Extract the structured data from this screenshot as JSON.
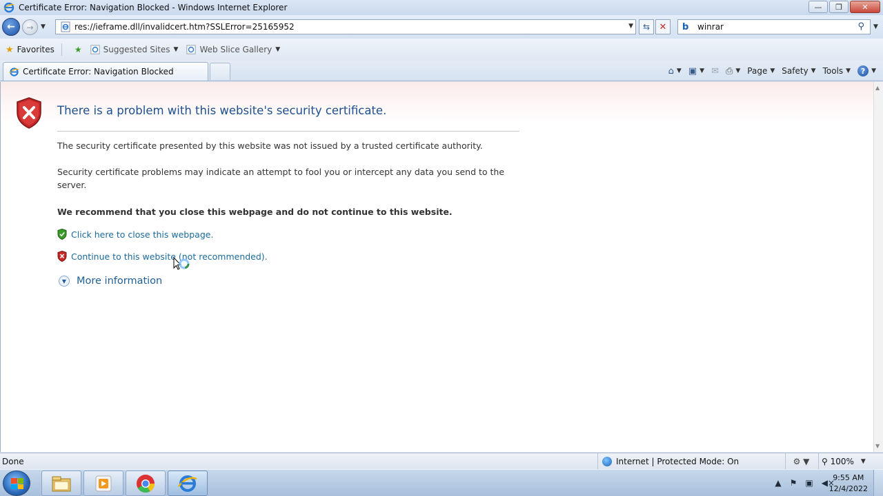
{
  "window": {
    "title": "Certificate Error: Navigation Blocked - Windows Internet Explorer",
    "buttons": {
      "minimize": "—",
      "maximize": "❐",
      "close": "✕"
    }
  },
  "address_bar": {
    "url": "res://ieframe.dll/invalidcert.htm?SSLError=25165952",
    "back_icon": "back-arrow-icon",
    "forward_icon": "forward-arrow-icon"
  },
  "search": {
    "value": "winrar",
    "provider_icon": "bing-icon"
  },
  "favorites_bar": {
    "favorites_label": "Favorites",
    "links": [
      {
        "label": "Suggested Sites"
      },
      {
        "label": "Web Slice Gallery"
      }
    ]
  },
  "tabs": [
    {
      "label": "Certificate Error: Navigation Blocked",
      "active": true
    }
  ],
  "command_bar": {
    "page": "Page",
    "safety": "Safety",
    "tools": "Tools",
    "help": "?"
  },
  "content": {
    "heading": "There is a problem with this website's security certificate.",
    "paragraph1": "The security certificate presented by this website was not issued by a trusted certificate authority.",
    "paragraph2": "Security certificate problems may indicate an attempt to fool you or intercept any data you send to the server.",
    "recommend": "We recommend that you close this webpage and do not continue to this website.",
    "close_link": "Click here to close this webpage.",
    "continue_link": "Continue to this website (not recommended).",
    "more_info": "More information"
  },
  "status_bar": {
    "left": "Done",
    "zone": "Internet | Protected Mode: On",
    "zoom": "100%"
  },
  "taskbar": {
    "items": [
      "file-explorer-icon",
      "media-player-icon",
      "chrome-icon",
      "internet-explorer-icon"
    ],
    "time": "9:55 AM",
    "date": "12/4/2022"
  },
  "colors": {
    "heading": "#1f4f8e",
    "link": "#1a6a9a",
    "error_shield": "#c62828",
    "safe_shield": "#3a9b2a"
  }
}
